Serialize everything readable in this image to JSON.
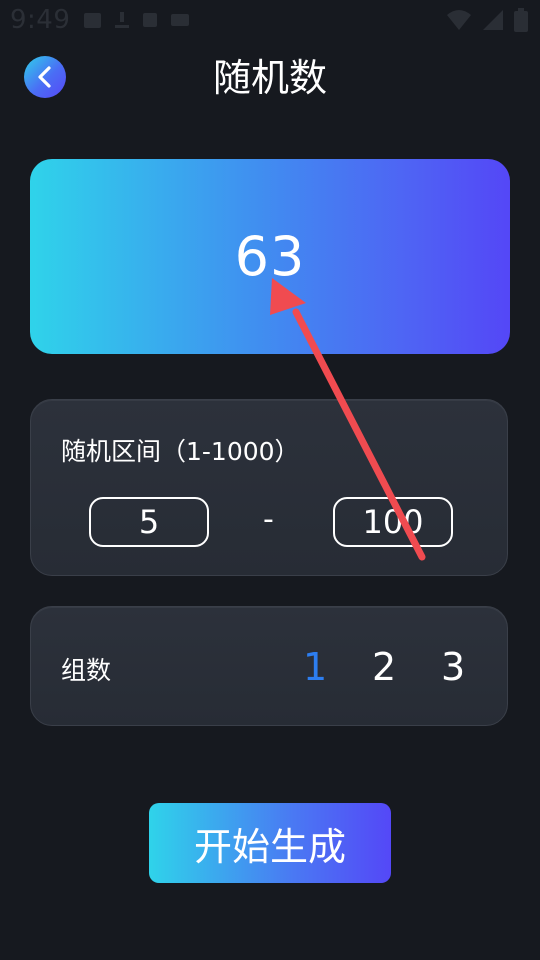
{
  "status_bar": {
    "time": "9:49"
  },
  "header": {
    "title": "随机数"
  },
  "result": {
    "value": "63"
  },
  "range": {
    "label": "随机区间（1-1000）",
    "min": "5",
    "separator": "-",
    "max": "100"
  },
  "groups": {
    "label": "组数",
    "options": [
      "1",
      "2",
      "3"
    ],
    "selected": "1"
  },
  "actions": {
    "generate_label": "开始生成"
  },
  "colors": {
    "background": "#16191f",
    "accent": "#2d7ef0",
    "gradient_start": "#2fd3ea",
    "gradient_end": "#5447f7",
    "annotation": "#f04b50"
  },
  "icons": [
    "image-icon",
    "download-icon",
    "a-icon",
    "keyboard-icon",
    "wifi-icon",
    "signal-icon",
    "battery-icon",
    "back-arrow-icon"
  ]
}
